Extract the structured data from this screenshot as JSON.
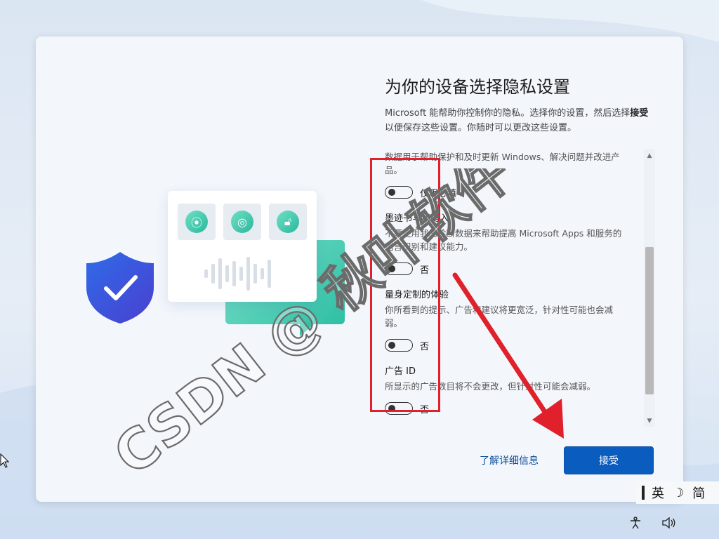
{
  "page": {
    "title": "为你的设备选择隐私设置",
    "description_prefix": "Microsoft 能帮助你控制你的隐私。选择你的设置，然后选择",
    "description_bold": "接受",
    "description_suffix": "以便保存这些设置。你随时可以更改这些设置。"
  },
  "settings": [
    {
      "title": "",
      "desc": "关及运行状况及其设置和功能以及它在何处运行的信息。诊断数据用于帮助保护和及时更新 Windows、解决问题并改进产品。",
      "toggle_label": "仅限必填"
    },
    {
      "title": "墨迹书写和键入",
      "desc": "不要使用我的诊断数据来帮助提高 Microsoft Apps 和服务的语言识别和建议能力。",
      "toggle_label": "否"
    },
    {
      "title": "量身定制的体验",
      "desc": "你所看到的提示、广告和建议将更宽泛，针对性可能也会减弱。",
      "toggle_label": "否"
    },
    {
      "title": "广告 ID",
      "desc": "所显示的广告数目将不会更改，但针对性可能会减弱。",
      "toggle_label": "否"
    }
  ],
  "actions": {
    "learn_more": "了解详细信息",
    "accept": "接受"
  },
  "ime": {
    "lang": "英",
    "mode": "简"
  },
  "watermark": {
    "text": "CSDN @ 秋叶软件"
  },
  "colors": {
    "accent": "#0b5cbf",
    "annotation_red": "#e0202a"
  }
}
